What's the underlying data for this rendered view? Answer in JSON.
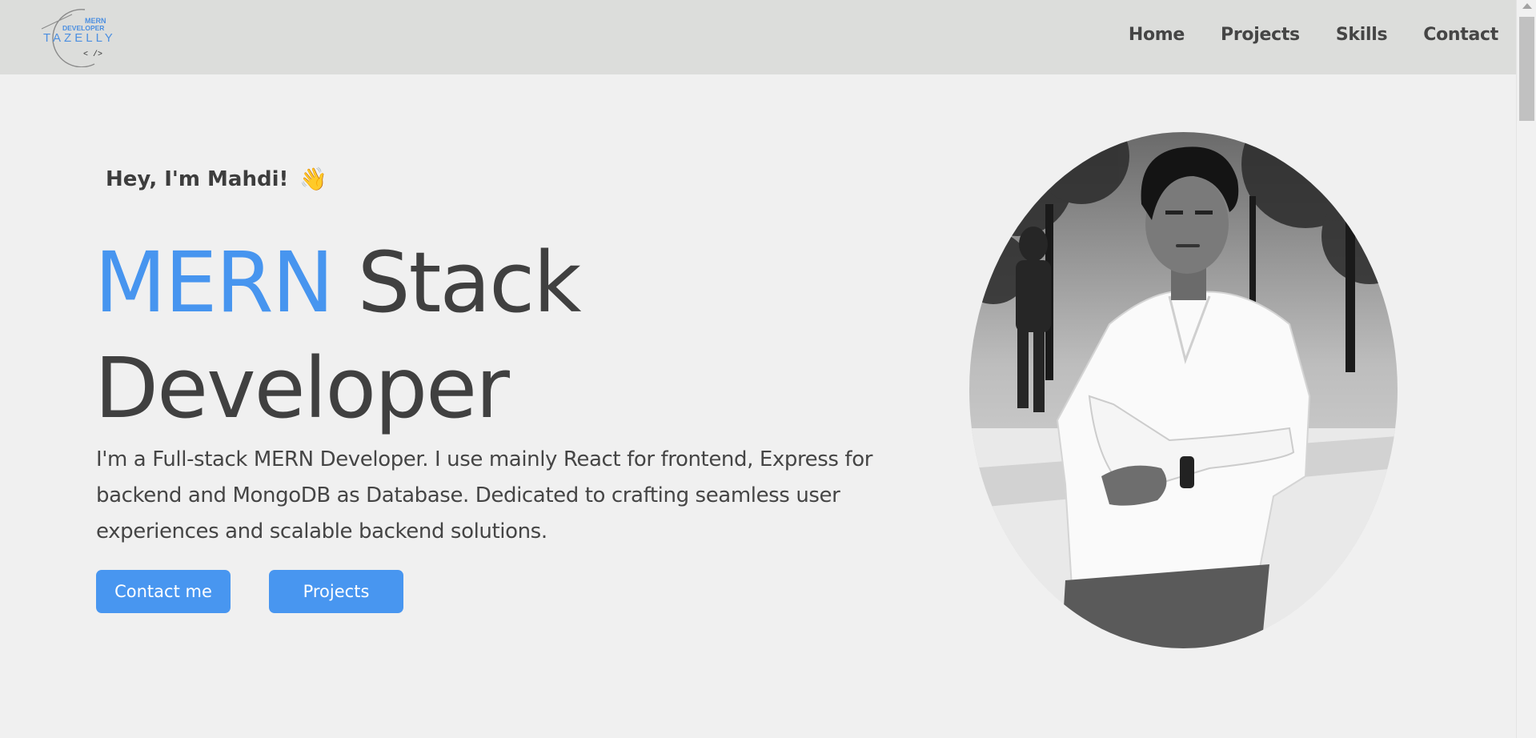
{
  "header": {
    "logo": {
      "top_text": "MERN",
      "mid_text": "DEVELOPER",
      "brand": "TAZELLY",
      "code": "< />"
    },
    "nav": [
      {
        "label": "Home"
      },
      {
        "label": "Projects"
      },
      {
        "label": "Skills"
      },
      {
        "label": "Contact"
      }
    ]
  },
  "hero": {
    "greeting": "Hey, I'm Mahdi!",
    "wave_emoji": "👋",
    "title_accent": "MERN",
    "title_rest": "Stack",
    "title_line2": "Developer",
    "description": "I'm a Full-stack MERN Developer. I use mainly React for frontend, Express for backend and MongoDB as Database. Dedicated to crafting seamless user experiences and scalable backend solutions.",
    "buttons": {
      "contact": "Contact me",
      "projects": "Projects"
    }
  },
  "colors": {
    "accent": "#4795ef",
    "button": "#4896f0",
    "header_bg": "#dcdddb",
    "page_bg": "#f0f0f0",
    "text": "#444444"
  },
  "icons": {
    "wave": "waving-hand-icon",
    "scroll_up": "chevron-up-icon"
  }
}
